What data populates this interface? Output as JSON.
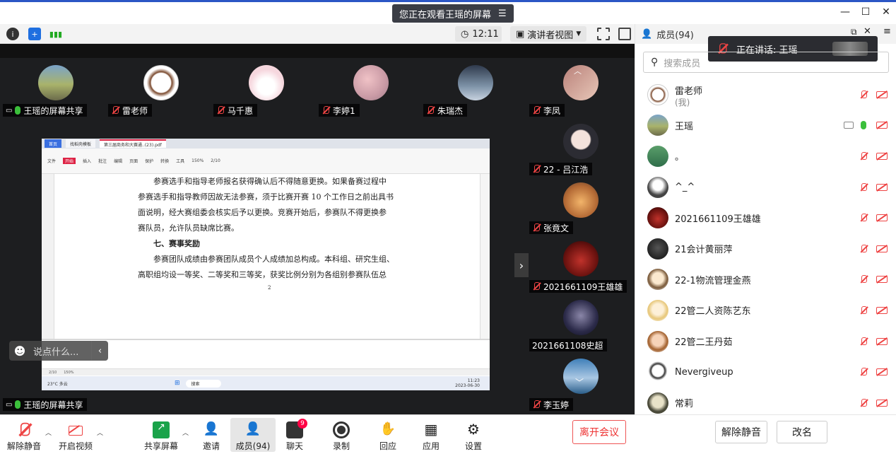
{
  "window": {
    "viewing_banner": "您正在观看王瑶的屏幕",
    "controls": [
      "—",
      "☐",
      "✕"
    ]
  },
  "topbar": {
    "time": "12:11",
    "view_mode": "演讲者视图"
  },
  "video_tiles": {
    "top_row": [
      {
        "name": "王瑶的屏幕共享",
        "mic": "on",
        "avatar": "landscape"
      },
      {
        "name": "雷老师",
        "mic": "off",
        "avatar": "seal"
      },
      {
        "name": "马千惠",
        "mic": "off",
        "avatar": "cartoon"
      },
      {
        "name": "李婷1",
        "mic": "off",
        "avatar": "flowers"
      },
      {
        "name": "朱瑞杰",
        "mic": "off",
        "avatar": "person"
      },
      {
        "name": "李凤",
        "mic": "off",
        "avatar": "photo"
      }
    ],
    "right_column": [
      {
        "name": "22 - 吕江浩",
        "mic": "off"
      },
      {
        "name": "张竟文",
        "mic": "off"
      },
      {
        "name": "2021661109王雄雄",
        "mic": "off"
      },
      {
        "name": "2021661108史超",
        "mic": "none"
      },
      {
        "name": "李玉婷",
        "mic": "off"
      }
    ],
    "bottom_label": "王瑶的屏幕共享"
  },
  "shared_pdf": {
    "tabs": [
      "首页",
      "找稻壳模板",
      "第三届商务和大赛通..(23).pdf"
    ],
    "ribbon": [
      "文件",
      "开始",
      "插入",
      "批注",
      "编辑",
      "页面",
      "保护",
      "转换",
      "工具"
    ],
    "lines": [
      "参赛选手和指导老师报名获得确认后不得随意更换。如果备赛过程中",
      "参赛选手和指导教师因故无法参赛，须于比赛开赛 10 个工作日之前出具书",
      "面说明，经大赛组委会核实后予以更换。竞赛开始后，参赛队不得更换参",
      "赛队员，允许队员缺席比赛。",
      "七、赛事奖励",
      "参赛团队成绩由参赛团队成员个人成绩加总构成。本科组、研究生组、",
      "高职组均设一等奖、二等奖和三等奖，获奖比例分别为各组别参赛队伍总"
    ],
    "page_number": "2",
    "status_page": "2/10",
    "zoom": "150%",
    "taskbar_search": "搜索",
    "taskbar_weather": "23°C 多云",
    "taskbar_time": "11:23",
    "taskbar_date": "2023-06-30"
  },
  "chat_input": {
    "placeholder": "说点什么..."
  },
  "bottom_toolbar": {
    "items": [
      {
        "label": "解除静音",
        "icon": "mic-off-icon"
      },
      {
        "label": "开启视频",
        "icon": "camera-off-icon"
      },
      {
        "label": "共享屏幕",
        "icon": "share-screen-icon"
      },
      {
        "label": "邀请",
        "icon": "invite-icon"
      },
      {
        "label": "成员(94)",
        "icon": "members-icon"
      },
      {
        "label": "聊天",
        "icon": "chat-icon",
        "badge": "9"
      },
      {
        "label": "录制",
        "icon": "record-icon"
      },
      {
        "label": "回应",
        "icon": "reaction-icon"
      },
      {
        "label": "应用",
        "icon": "apps-icon"
      },
      {
        "label": "设置",
        "icon": "settings-icon"
      }
    ],
    "leave": "离开会议"
  },
  "members_panel": {
    "title": "成员(94)",
    "speaking": "正在讲话: 王瑶",
    "search_placeholder": "搜索成员",
    "members": [
      {
        "name": "雷老师",
        "sub": "(我)",
        "mic": "off",
        "cam": "off"
      },
      {
        "name": "王瑶",
        "mic": "on",
        "cam": "off",
        "sharing": true
      },
      {
        "name": "。",
        "mic": "off",
        "cam": "off"
      },
      {
        "name": "^_^",
        "mic": "off",
        "cam": "off"
      },
      {
        "name": "2021661109王雄雄",
        "mic": "off",
        "cam": "off"
      },
      {
        "name": "21会计黄丽萍",
        "mic": "off",
        "cam": "off"
      },
      {
        "name": "22-1物流管理金燕",
        "mic": "off",
        "cam": "off"
      },
      {
        "name": "22管二人资陈艺东",
        "mic": "off",
        "cam": "off"
      },
      {
        "name": "22管二王丹茹",
        "mic": "off",
        "cam": "off"
      },
      {
        "name": "Nevergiveup",
        "mic": "off",
        "cam": "off"
      },
      {
        "name": "常莉",
        "mic": "off",
        "cam": "off"
      }
    ],
    "footer": {
      "mute_all": "解除静音",
      "rename": "改名"
    }
  },
  "colors": {
    "accent": "#2b56c5",
    "danger": "#e44444",
    "mic_on": "#3bbf3b",
    "dark_bg": "#1d1e20"
  }
}
